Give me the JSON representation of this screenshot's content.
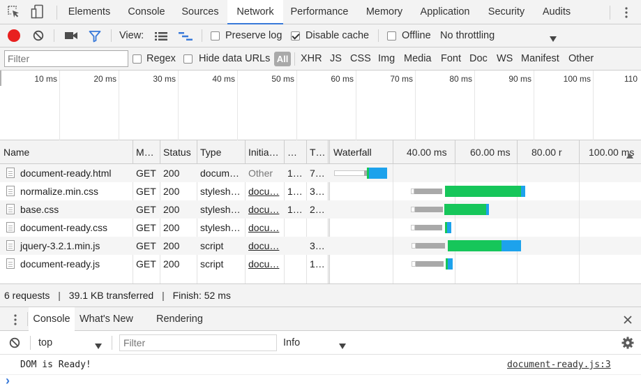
{
  "tabs": [
    {
      "label": "Elements"
    },
    {
      "label": "Console"
    },
    {
      "label": "Sources"
    },
    {
      "label": "Network"
    },
    {
      "label": "Performance"
    },
    {
      "label": "Memory"
    },
    {
      "label": "Application"
    },
    {
      "label": "Security"
    },
    {
      "label": "Audits"
    }
  ],
  "active_tab": "Network",
  "toolbar": {
    "view_label": "View:",
    "preserve_log": {
      "label": "Preserve log",
      "checked": false
    },
    "disable_cache": {
      "label": "Disable cache",
      "checked": true
    },
    "offline": {
      "label": "Offline",
      "checked": false
    },
    "throttling": "No throttling"
  },
  "filterbar": {
    "placeholder": "Filter",
    "regex": {
      "label": "Regex",
      "checked": false
    },
    "hide_data_urls": {
      "label": "Hide data URLs",
      "checked": false
    },
    "types": [
      "All",
      "XHR",
      "JS",
      "CSS",
      "Img",
      "Media",
      "Font",
      "Doc",
      "WS",
      "Manifest",
      "Other"
    ],
    "active_type": "All"
  },
  "overview": {
    "ticks": [
      "10 ms",
      "20 ms",
      "30 ms",
      "40 ms",
      "50 ms",
      "60 ms",
      "70 ms",
      "80 ms",
      "90 ms",
      "100 ms",
      "110"
    ]
  },
  "table": {
    "columns": [
      "Name",
      "M…",
      "Status",
      "Type",
      "Initia…",
      "…",
      "T…",
      "Waterfall"
    ],
    "waterfall_ticks": [
      "40.00 ms",
      "60.00 ms",
      "80.00 r",
      "100.00 ms"
    ],
    "rows": [
      {
        "name": "document-ready.html",
        "method": "GET",
        "status": "200",
        "type": "docum…",
        "initiator": "Other",
        "size": "1…",
        "time": "7…"
      },
      {
        "name": "normalize.min.css",
        "method": "GET",
        "status": "200",
        "type": "stylesh…",
        "initiator": "docu…",
        "size": "1…",
        "time": "3…"
      },
      {
        "name": "base.css",
        "method": "GET",
        "status": "200",
        "type": "stylesh…",
        "initiator": "docu…",
        "size": "1…",
        "time": "2…"
      },
      {
        "name": "document-ready.css",
        "method": "GET",
        "status": "200",
        "type": "stylesh…",
        "initiator": "docu…",
        "size": "",
        "time": ""
      },
      {
        "name": "jquery-3.2.1.min.js",
        "method": "GET",
        "status": "200",
        "type": "script",
        "initiator": "docu…",
        "size": "",
        "time": "3…"
      },
      {
        "name": "document-ready.js",
        "method": "GET",
        "status": "200",
        "type": "script",
        "initiator": "docu…",
        "size": "",
        "time": "1…"
      }
    ]
  },
  "summary": {
    "requests": "6 requests",
    "transferred": "39.1 KB transferred",
    "finish": "Finish: 52 ms",
    "separator": "|"
  },
  "drawer": {
    "tabs": [
      "Console",
      "What's New",
      "Rendering"
    ],
    "active_tab": "Console",
    "context": "top",
    "filter_placeholder": "Filter",
    "level": "Info",
    "messages": [
      {
        "text": "DOM is Ready!",
        "source": "document-ready.js:3"
      }
    ],
    "prompt": "›"
  },
  "colors": {
    "accent": "#3879d9",
    "record": "#e8201f",
    "waiting": "#16c65a",
    "download": "#1da2ec",
    "queued": "#a9a9a9"
  }
}
